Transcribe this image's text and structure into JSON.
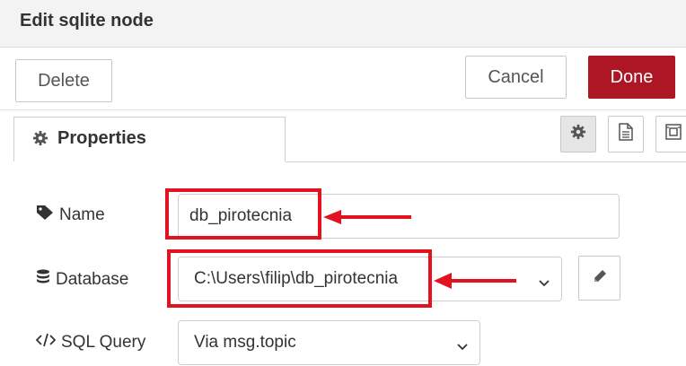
{
  "dialog": {
    "title": "Edit sqlite node"
  },
  "toolbar": {
    "delete_label": "Delete",
    "cancel_label": "Cancel",
    "done_label": "Done"
  },
  "tabs": [
    {
      "label": "Properties",
      "icon": "gear-icon"
    }
  ],
  "tab_icons": [
    "gear-icon",
    "document-icon",
    "frame-icon"
  ],
  "form": {
    "name": {
      "label": "Name",
      "icon": "tag-icon",
      "value": "db_pirotecnia"
    },
    "database": {
      "label": "Database",
      "icon": "database-icon",
      "value": "C:\\Users\\filip\\db_pirotecnia"
    },
    "sql_query": {
      "label": "SQL Query",
      "icon": "code-icon",
      "value": "Via msg.topic"
    }
  },
  "colors": {
    "done_button": "#ad1625",
    "annotation": "#e0131f"
  }
}
